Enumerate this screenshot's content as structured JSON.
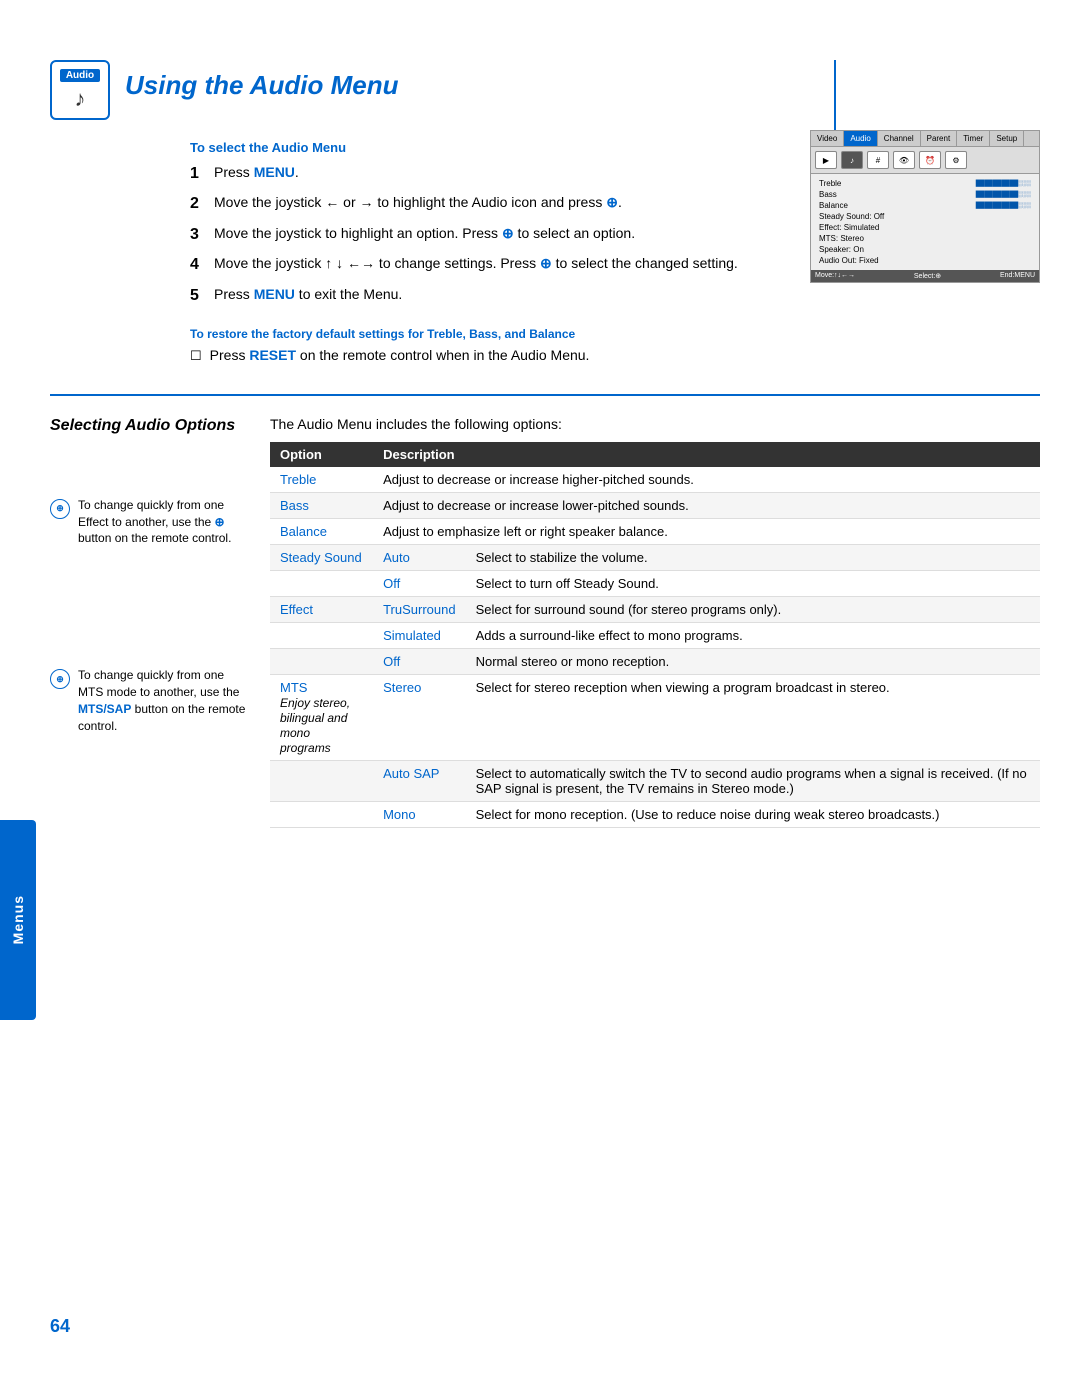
{
  "page": {
    "number": "64",
    "side_tab_label": "Menus"
  },
  "header": {
    "icon_label": "Audio",
    "icon_symbol": "♪",
    "title": "Using the Audio Menu"
  },
  "steps_section": {
    "subtitle": "To select the Audio Menu",
    "steps": [
      {
        "number": "1",
        "text_before": "Press ",
        "highlight": "MENU",
        "text_after": "."
      },
      {
        "number": "2",
        "text_before": "Move the joystick ← or → to highlight the Audio icon and press ",
        "highlight": "⊕",
        "text_after": "."
      },
      {
        "number": "3",
        "text_before": "Move the joystick to highlight an option. Press ",
        "highlight": "⊕",
        "text_after": " to select an option."
      },
      {
        "number": "4",
        "text_before": "Move the joystick ↑ ↓ ←→ to change settings. Press ",
        "highlight": "⊕",
        "text_after": " to select the changed setting."
      },
      {
        "number": "5",
        "text_before": "Press ",
        "highlight": "MENU",
        "text_after": " to exit the Menu."
      }
    ]
  },
  "restore_section": {
    "title": "To restore the factory default settings for Treble, Bass, and Balance",
    "text_before": "Press ",
    "highlight": "RESET",
    "text_after": " on the remote control when in the Audio Menu."
  },
  "tv_screenshot": {
    "menu_items": [
      "Video",
      "Audio",
      "Channel",
      "Parent",
      "Timer",
      "Setup"
    ],
    "active_menu": "Audio",
    "menu_options": [
      {
        "label": "Treble",
        "value": "bar"
      },
      {
        "label": "Bass",
        "value": "bar"
      },
      {
        "label": "Balance",
        "value": "bar"
      },
      {
        "label": "Steady Sound: Off",
        "value": ""
      },
      {
        "label": "Effect: Simulated",
        "value": ""
      },
      {
        "label": "MTS: Stereo",
        "value": ""
      },
      {
        "label": "Speaker: On",
        "value": ""
      },
      {
        "label": "Audio Out: Fixed",
        "value": ""
      }
    ],
    "footer": {
      "move_label": "Move:",
      "select_label": "Select:",
      "end_label": "End:",
      "end_key": "MENU"
    }
  },
  "selecting_audio": {
    "heading": "Selecting Audio Options",
    "intro": "The Audio Menu includes the following options:",
    "table": {
      "col1": "Option",
      "col2": "Description",
      "rows": [
        {
          "option": "Treble",
          "sub_option": "",
          "italic": "",
          "description": "Adjust to decrease or increase higher-pitched sounds."
        },
        {
          "option": "Bass",
          "sub_option": "",
          "italic": "",
          "description": "Adjust to decrease or increase lower-pitched sounds."
        },
        {
          "option": "Balance",
          "sub_option": "",
          "italic": "",
          "description": "Adjust to emphasize left or right speaker balance."
        },
        {
          "option": "Steady Sound",
          "sub_option": "Auto",
          "italic": "",
          "description": "Select to stabilize the volume."
        },
        {
          "option": "",
          "sub_option": "Off",
          "italic": "",
          "description": "Select to turn off Steady Sound."
        },
        {
          "option": "Effect",
          "sub_option": "TruSurround",
          "italic": "",
          "description": "Select for surround sound (for stereo programs only)."
        },
        {
          "option": "",
          "sub_option": "Simulated",
          "italic": "",
          "description": "Adds a surround-like effect to mono programs."
        },
        {
          "option": "",
          "sub_option": "Off",
          "italic": "",
          "description": "Normal stereo or mono reception."
        },
        {
          "option": "MTS",
          "sub_option": "Stereo",
          "italic": "Enjoy stereo, bilingual and mono programs",
          "description": "Select for stereo reception when viewing a program broadcast in stereo."
        },
        {
          "option": "",
          "sub_option": "Auto SAP",
          "italic": "",
          "description": "Select to automatically switch the TV to second audio programs when a signal is received. (If no SAP signal is present, the TV remains in Stereo mode.)"
        },
        {
          "option": "",
          "sub_option": "Mono",
          "italic": "",
          "description": "Select for mono reception. (Use to reduce noise during weak stereo broadcasts.)"
        }
      ]
    }
  },
  "notes": [
    {
      "icon": "⊕",
      "text": "To change quickly from one Effect to another, use the ⊕ button on the remote control."
    },
    {
      "icon": "⊕",
      "text": "To change quickly from one MTS mode to another, use the MTS/SAP button on the remote control.",
      "link_text": "MTS/SAP"
    }
  ]
}
